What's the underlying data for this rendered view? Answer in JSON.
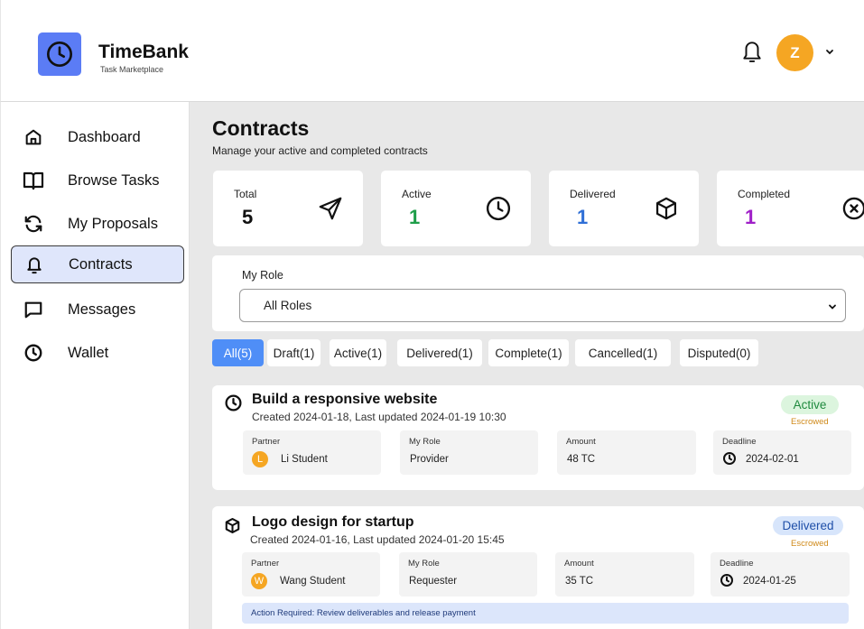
{
  "app": {
    "name": "TimeBank",
    "tagline": "Task Marketplace",
    "user_initial": "Z"
  },
  "sidebar": {
    "items": [
      {
        "label": "Dashboard",
        "icon": "home-icon"
      },
      {
        "label": "Browse Tasks",
        "icon": "book-icon"
      },
      {
        "label": "My Proposals",
        "icon": "refresh-icon"
      },
      {
        "label": "Contracts",
        "icon": "bell-icon",
        "active": true
      },
      {
        "label": "Messages",
        "icon": "message-icon"
      },
      {
        "label": "Wallet",
        "icon": "clock-icon"
      }
    ]
  },
  "page": {
    "title": "Contracts",
    "subtitle": "Manage your active and completed contracts"
  },
  "stats": [
    {
      "label": "Total",
      "value": "5",
      "color": "#111111",
      "icon": "send-icon"
    },
    {
      "label": "Active",
      "value": "1",
      "color": "#1f9e4a",
      "icon": "clock-icon"
    },
    {
      "label": "Delivered",
      "value": "1",
      "color": "#2f6fd6",
      "icon": "box-icon"
    },
    {
      "label": "Completed",
      "value": "1",
      "color": "#a020c8",
      "icon": "x-circle-icon"
    }
  ],
  "filter": {
    "label": "My Role",
    "selected": "All Roles"
  },
  "tabs": [
    {
      "label": "All(5)",
      "active": true
    },
    {
      "label": "Draft(1)"
    },
    {
      "label": "Active(1)"
    },
    {
      "label": "Delivered(1)"
    },
    {
      "label": "Complete(1)"
    },
    {
      "label": "Cancelled(1)"
    },
    {
      "label": "Disputed(0)"
    }
  ],
  "labels": {
    "partner": "Partner",
    "my_role": "My Role",
    "amount": "Amount",
    "deadline": "Deadline"
  },
  "contracts": [
    {
      "title": "Build a responsive website",
      "meta": "Created 2024-01-18, Last updated 2024-01-19 10:30",
      "status": "Active",
      "escrow": "Escrowed",
      "partner": "Li Student",
      "partner_initial": "L",
      "role": "Provider",
      "amount": "48 TC",
      "deadline": "2024-02-01",
      "icon": "clock-icon"
    },
    {
      "title": "Logo design for startup",
      "meta": "Created 2024-01-16, Last updated 2024-01-20 15:45",
      "status": "Delivered",
      "escrow": "Escrowed",
      "partner": "Wang Student",
      "partner_initial": "W",
      "role": "Requester",
      "amount": "35 TC",
      "deadline": "2024-01-25",
      "action": "Action Required: Review deliverables and release payment",
      "icon": "box-icon"
    }
  ],
  "colors": {
    "brand": "#5b7cf5",
    "active_green": "#1f9e4a",
    "delivered_blue": "#2f6fd6",
    "completed_purple": "#a020c8",
    "avatar_orange": "#f5a623",
    "escrow_orange": "#d08a1a"
  }
}
